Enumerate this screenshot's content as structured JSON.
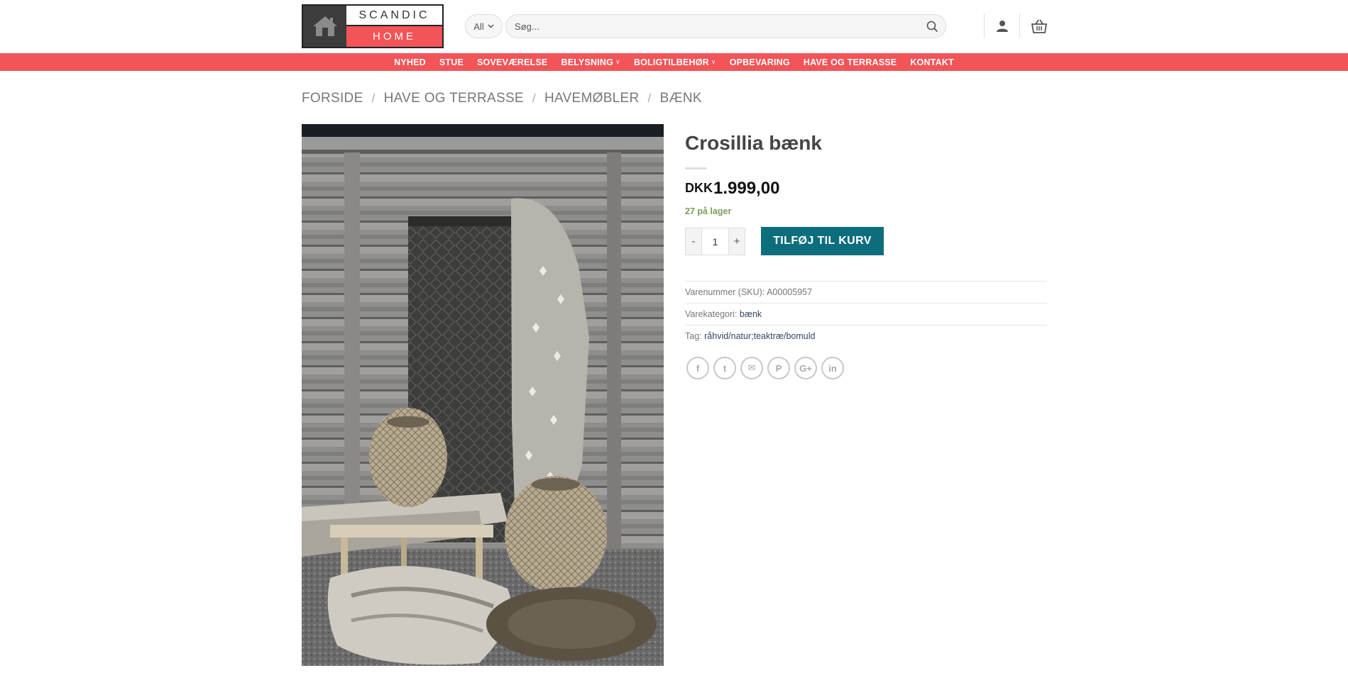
{
  "logo": {
    "top_text": "SCANDIC",
    "bottom_text": "HOME"
  },
  "search": {
    "category": "All",
    "placeholder": "Søg..."
  },
  "header_icons": {
    "account": "user-icon",
    "cart": "basket-icon"
  },
  "nav": {
    "items": [
      {
        "label": "NYHED",
        "dropdown": false
      },
      {
        "label": "STUE",
        "dropdown": false
      },
      {
        "label": "SOVEVÆRELSE",
        "dropdown": false
      },
      {
        "label": "BELYSNING",
        "dropdown": true
      },
      {
        "label": "BOLIGTILBEHØR",
        "dropdown": true
      },
      {
        "label": "OPBEVARING",
        "dropdown": false
      },
      {
        "label": "HAVE OG TERRASSE",
        "dropdown": false
      },
      {
        "label": "KONTAKT",
        "dropdown": false
      }
    ]
  },
  "breadcrumb": {
    "items": [
      "FORSIDE",
      "HAVE OG TERRASSE",
      "HAVEMØBLER",
      "BÆNK"
    ],
    "separator": "/"
  },
  "product": {
    "title": "Crosillia bænk",
    "currency": "DKK",
    "price": "1.999,00",
    "stock": "27 på lager",
    "quantity": "1",
    "qty_minus": "-",
    "qty_plus": "+",
    "add_to_cart": "TILFØJ TIL KURV",
    "sku_label": "Varenummer (SKU):",
    "sku": "A00005957",
    "category_label": "Varekategori:",
    "category": "bænk",
    "tag_label": "Tag:",
    "tags": "råhvid/natur;teaktræ/bomuld"
  },
  "share": {
    "icons": [
      "facebook-icon",
      "twitter-icon",
      "email-icon",
      "pinterest-icon",
      "google-plus-icon",
      "linkedin-icon"
    ],
    "glyphs": [
      "f",
      "t",
      "✉",
      "P",
      "G+",
      "in"
    ]
  },
  "colors": {
    "brand_red": "#f25457",
    "button_teal": "#0c6e7d",
    "stock_green": "#7a9c59",
    "link_blue": "#334862"
  }
}
